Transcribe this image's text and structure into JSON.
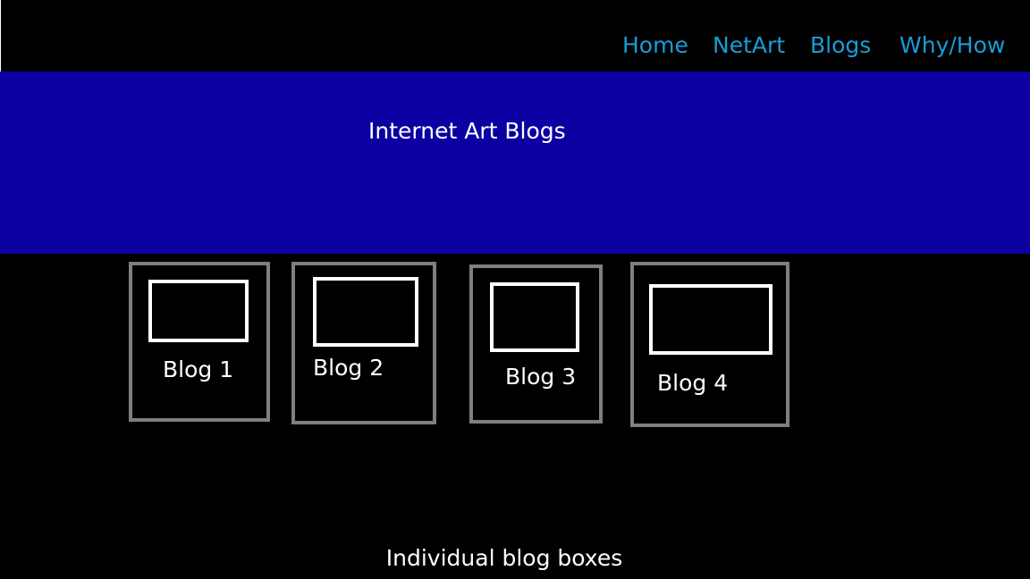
{
  "nav": {
    "items": [
      {
        "label": "Home"
      },
      {
        "label": "NetArt"
      },
      {
        "label": "Blogs"
      },
      {
        "label": "Why/How"
      }
    ],
    "link_color": "#1a9bd7"
  },
  "banner": {
    "title": "Internet Art Blogs",
    "background_color": "#0d00a3"
  },
  "blog_cards": [
    {
      "label": "Blog 1"
    },
    {
      "label": "Blog 2"
    },
    {
      "label": "Blog 3"
    },
    {
      "label": "Blog 4"
    }
  ],
  "caption": "Individual blog boxes"
}
